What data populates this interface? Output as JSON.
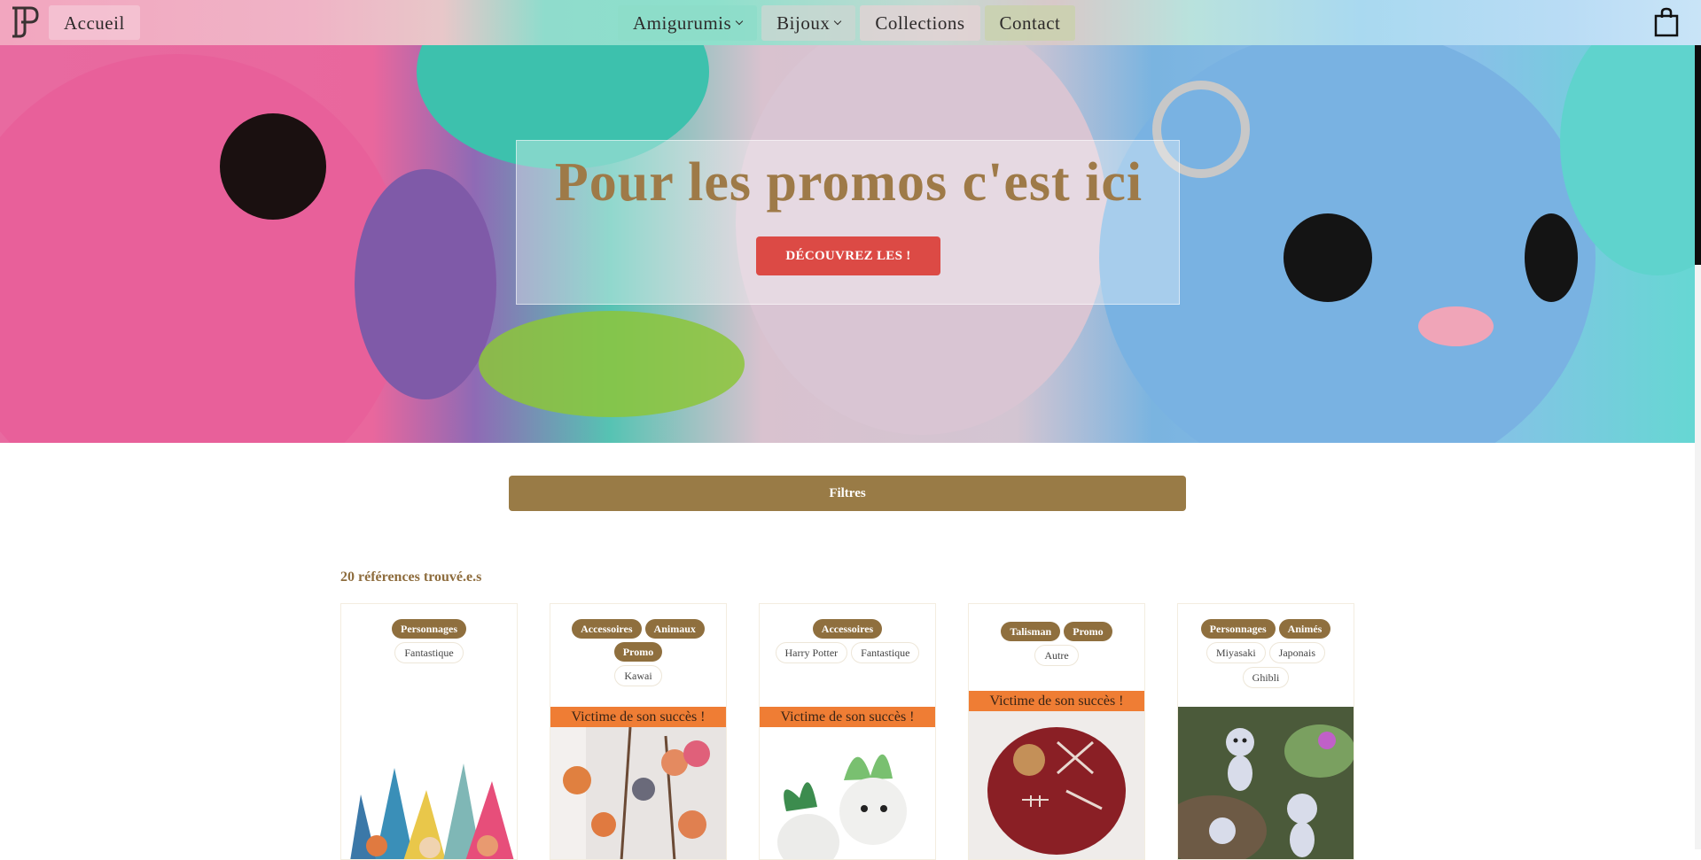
{
  "header": {
    "home_label": "Accueil",
    "nav": [
      {
        "label": "Amigurumis",
        "has_dropdown": true
      },
      {
        "label": "Bijoux",
        "has_dropdown": true
      },
      {
        "label": "Collections",
        "has_dropdown": false
      },
      {
        "label": "Contact",
        "has_dropdown": false
      }
    ],
    "logo_icon": "logo-icon",
    "cart_icon": "shopping-bag-icon"
  },
  "hero": {
    "title": "Pour les promos c'est ici",
    "cta_label": "DÉCOUVREZ LES !"
  },
  "filters": {
    "label": "Filtres"
  },
  "results": {
    "count_label": "20 références trouvé.e.s"
  },
  "products": [
    {
      "primary_tags": [
        "Personnages"
      ],
      "secondary_tags": [
        "Fantastique"
      ],
      "banner": ""
    },
    {
      "primary_tags": [
        "Accessoires",
        "Animaux",
        "Promo"
      ],
      "secondary_tags": [
        "Kawai"
      ],
      "banner": "Victime de son succès !"
    },
    {
      "primary_tags": [
        "Accessoires"
      ],
      "secondary_tags": [
        "Harry Potter",
        "Fantastique"
      ],
      "banner": "Victime de son succès !"
    },
    {
      "primary_tags": [
        "Talisman",
        "Promo"
      ],
      "secondary_tags": [
        "Autre"
      ],
      "banner": "Victime de son succès !"
    },
    {
      "primary_tags": [
        "Personnages",
        "Animés"
      ],
      "secondary_tags": [
        "Miyasaki",
        "Japonais",
        "Ghibli"
      ],
      "banner": ""
    }
  ],
  "colors": {
    "accent": "#997b46",
    "cta": "#dc4a45",
    "banner": "#ef7d34",
    "title": "#9e7a48"
  }
}
